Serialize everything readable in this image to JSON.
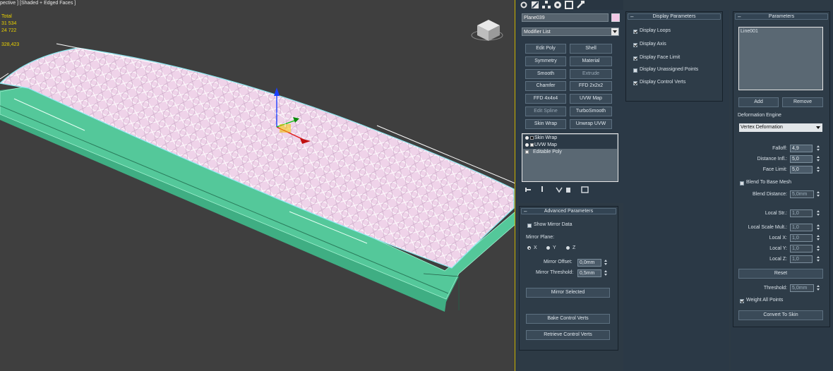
{
  "viewport": {
    "label": "pective ] [Shaded + Edged Faces ]",
    "stats": {
      "total_label": "Total",
      "polys": "31 534",
      "verts": "24 722",
      "fps": "328,423"
    }
  },
  "command_panel": {
    "tabs": [
      "create-icon",
      "modify-icon",
      "hierarchy-icon",
      "motion-icon",
      "display-icon",
      "utilities-icon"
    ],
    "object_name": "Plane039",
    "object_color": "#f2c8e6",
    "modifier_list": "Modifier List",
    "modifier_buttons": [
      "Edit Poly",
      "Shell",
      "Symmetry",
      "Material",
      "Smooth",
      "Extrude",
      "Chamfer",
      "FFD 2x2x2",
      "FFD 4x4x4",
      "UVW Map",
      "Edit Spline",
      "TurboSmooth",
      "Skin Wrap",
      "Unwrap UVW"
    ],
    "stack": [
      {
        "label": "Skin Wrap",
        "selected": true
      },
      {
        "label": "UVW Map",
        "selected": false
      },
      {
        "label": "Editable Poly",
        "selected": false
      }
    ]
  },
  "advanced": {
    "title": "Advanced Parameters",
    "show_mirror_data": "Show Mirror Data",
    "mirror_plane_label": "Mirror Plane:",
    "axes": [
      "X",
      "Y",
      "Z"
    ],
    "mirror_offset_label": "Mirror Offset:",
    "mirror_offset": "0,0mm",
    "mirror_threshold_label": "Mirror Threshold:",
    "mirror_threshold": "0,5mm",
    "mirror_selected": "Mirror Selected",
    "bake": "Bake Control Verts",
    "retrieve": "Retrieve Control Verts"
  },
  "display": {
    "title": "Display Parameters",
    "items": [
      {
        "label": "Display Loops",
        "checked": true
      },
      {
        "label": "Display Axis",
        "checked": true
      },
      {
        "label": "Display Face Limit",
        "checked": true
      },
      {
        "label": "Display Unassigned Points",
        "checked": false
      },
      {
        "label": "Display Control Verts",
        "checked": true
      }
    ]
  },
  "parameters": {
    "title": "Parameters",
    "list_items": [
      "Line001"
    ],
    "add": "Add",
    "remove": "Remove",
    "engine_label": "Deformation Engine",
    "engine_value": "Vertex Deformation",
    "falloff_label": "Falloff:",
    "falloff": "4,9",
    "distance_label": "Distance Infl.:",
    "distance": "5,0",
    "face_limit_label": "Face Limit:",
    "face_limit": "5,0",
    "blend_to_base": "Blend To Base Mesh",
    "blend_distance_label": "Blend Distance:",
    "blend_distance": "5,0mm",
    "local_str_label": "Local Str.:",
    "local_str": "1,0",
    "local_scale_label": "Local Scale Mult.:",
    "local_scale": "1,0",
    "local_x_label": "Local X:",
    "local_x": "1,0",
    "local_y_label": "Local Y:",
    "local_y": "1,0",
    "local_z_label": "Local Z:",
    "local_z": "1,0",
    "reset": "Reset",
    "threshold_label": "Threshold:",
    "threshold": "5,0mm",
    "weight_all": "Weight All Points",
    "convert": "Convert To Skin"
  }
}
